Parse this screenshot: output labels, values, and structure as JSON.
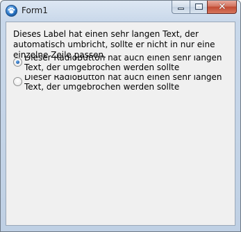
{
  "window": {
    "title": "Form1",
    "buttons": {
      "minimize": "minimize",
      "maximize": "maximize",
      "close": "close"
    }
  },
  "label": {
    "text": "Dieses Label hat einen sehr langen Text, der automatisch umbricht, sollte er nicht in nur eine einzelne Zeile passen."
  },
  "radios": [
    {
      "text": "Dieser RadioButton hat auch einen sehr langen Text, der umgebrochen werden sollte",
      "checked": true
    },
    {
      "text": "Dieser RadioButton hat auch einen sehr langen Text, der umgebrochen werden sollte",
      "checked": false
    }
  ],
  "colors": {
    "client_background": "#f0f0f0",
    "close_button": "#c24a33",
    "radio_checked": "#1c5aa8"
  }
}
